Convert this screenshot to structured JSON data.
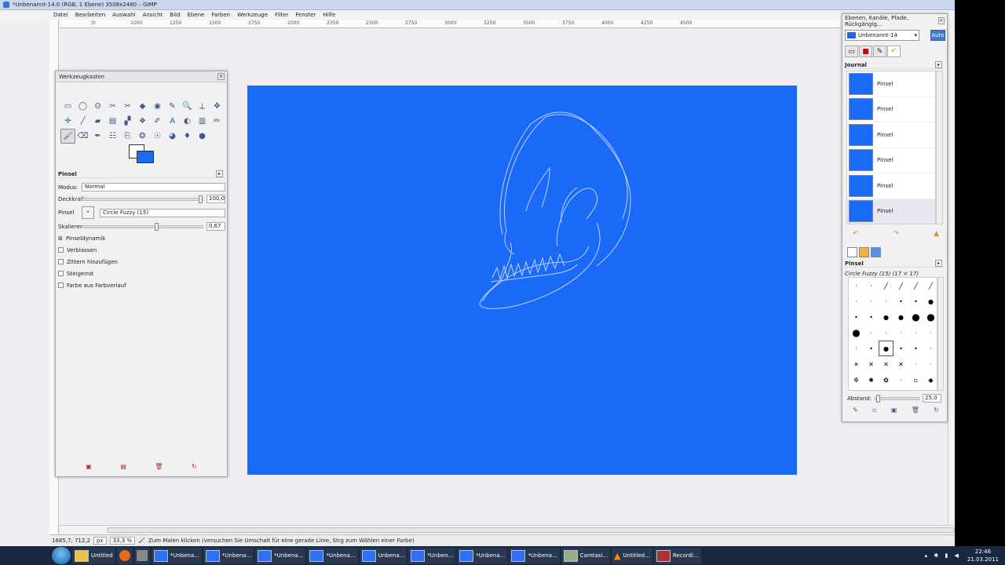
{
  "window_title": "*Unbenannt-14.0 (RGB, 1 Ebene) 3508x2480 – GIMP",
  "menu": [
    "Datei",
    "Bearbeiten",
    "Auswahl",
    "Ansicht",
    "Bild",
    "Ebene",
    "Farben",
    "Werkzeuge",
    "Filter",
    "Fenster",
    "Hilfe"
  ],
  "ruler_labels": [
    "|0",
    "1000",
    "1250",
    "1500",
    "1750",
    "2000",
    "2250",
    "2500",
    "2750",
    "3000",
    "3250",
    "3500",
    "3750",
    "4000",
    "4250",
    "4500"
  ],
  "colors": {
    "canvas": "#1b6af7",
    "background": "#efedf1"
  },
  "toolbox": {
    "title": "Werkzeugkasten",
    "tool_icons": [
      "▭",
      "◯",
      "ʘ",
      "✂",
      "✂",
      "◆",
      "◉",
      "✎",
      "🔍",
      "⟂",
      "✥",
      "✛",
      "╱",
      "▰",
      "▤",
      "▞",
      "❖",
      "✐",
      "A",
      "◐",
      "▥",
      "✏",
      "🖌",
      "⌫",
      "✒",
      "☷",
      "⎘",
      "❂",
      "☉",
      "◕",
      "♦",
      "●"
    ],
    "options_title": "Pinsel",
    "modus_label": "Modus:",
    "modus_value": "Normal",
    "deckkraft_label": "Deckkraft:",
    "deckkraft_value": "100,0",
    "pinsel_label": "Pinsel",
    "pinsel_value": "Circle Fuzzy (15)",
    "skalieren_label": "Skalieren:",
    "skalieren_value": "0,67",
    "pinseldynamik": "Pinseldynamik",
    "checkboxes": [
      "Verblassen",
      "Zittern hinzufügen",
      "Steigernd",
      "Farbe aus Farbverlauf"
    ],
    "bottom_icons": [
      "▣",
      "▤",
      "🗑",
      "↻"
    ]
  },
  "dock": {
    "title": "Ebenen, Kanäle, Pfade, Rückgängig...",
    "image_select": "Unbenannt-14",
    "auto_label": "Auto",
    "journal_title": "Journal",
    "journal_items": [
      "Pinsel",
      "Pinsel",
      "Pinsel",
      "Pinsel",
      "Pinsel",
      "Pinsel"
    ],
    "brushes_title": "Pinsel",
    "brush_name": "Circle Fuzzy (15) (17 × 17)",
    "abstand_label": "Abstand:",
    "abstand_value": "25,0"
  },
  "status": {
    "coords": "1685,7, 712,2",
    "unit": "px",
    "zoom": "33,3 %",
    "message": "Zum Malen klicken (versuchen Sie Umschalt für eine gerade Linie, Strg zum Wählen einer Farbe)"
  },
  "taskbar": {
    "items": [
      "Untitled",
      "*Unbena...",
      "*Unbena...",
      "*Unbena...",
      "*Unbena...",
      "Unbena...",
      "*Unben...",
      "*Unbena...",
      "*Unbena...",
      "Camtasi...",
      "Untitled...",
      "Recordi..."
    ],
    "time": "22:46",
    "date": "21.03.2011"
  }
}
